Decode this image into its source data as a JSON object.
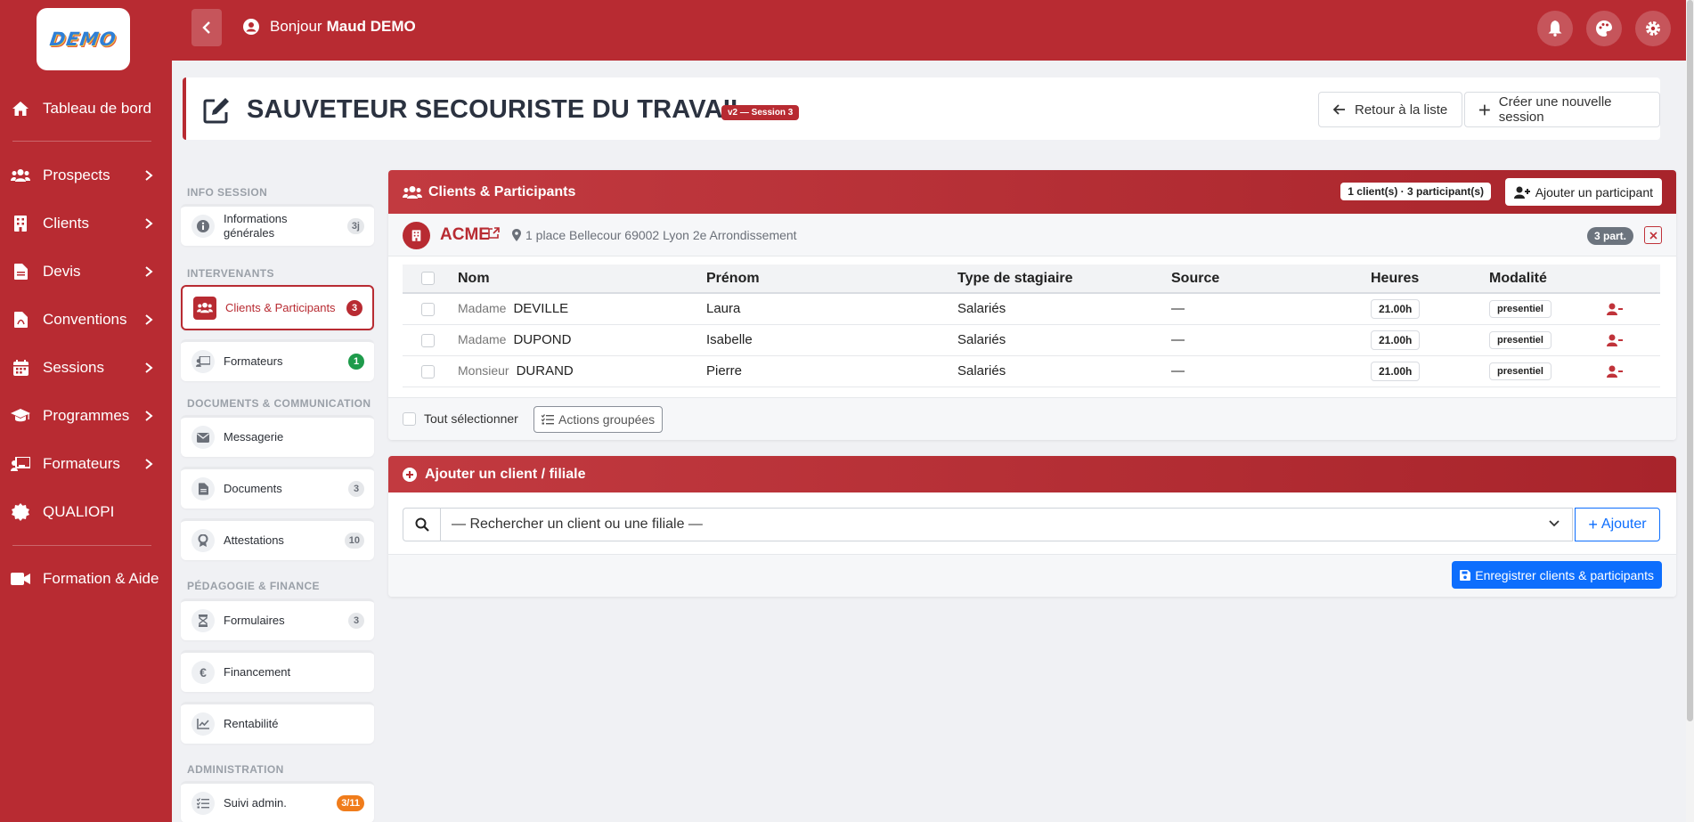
{
  "logo": {
    "text": "DEMO"
  },
  "sidebar": {
    "items": [
      {
        "label": "Tableau de bord",
        "icon": "home-icon",
        "chevron": false
      },
      {
        "label": "Prospects",
        "icon": "users-icon",
        "chevron": true
      },
      {
        "label": "Clients",
        "icon": "building-icon",
        "chevron": true
      },
      {
        "label": "Devis",
        "icon": "file-icon",
        "chevron": true
      },
      {
        "label": "Conventions",
        "icon": "file-pdf-icon",
        "chevron": true
      },
      {
        "label": "Sessions",
        "icon": "calendar-icon",
        "chevron": true
      },
      {
        "label": "Programmes",
        "icon": "graduation-cap-icon",
        "chevron": true
      },
      {
        "label": "Formateurs",
        "icon": "chalkboard-teacher-icon",
        "chevron": true
      },
      {
        "label": "QUALIOPI",
        "icon": "certificate-icon",
        "chevron": false
      },
      {
        "label": "Formation & Aide",
        "icon": "video-icon",
        "chevron": false
      }
    ]
  },
  "header": {
    "greeting": "Bonjour",
    "user_name": "Maud DEMO"
  },
  "title_card": {
    "title": "SAUVETEUR SECOURISTE DU TRAVAIL",
    "version_badge": "v2 — Session 3",
    "back_to_list": "Retour à la liste",
    "create_session": "Créer une nouvelle session"
  },
  "section_nav": {
    "groups": [
      {
        "heading": "INFO SESSION"
      },
      {
        "heading": "INTERVENANTS"
      },
      {
        "heading": "DOCUMENTS & COMMUNICATION"
      },
      {
        "heading": "PÉDAGOGIE & FINANCE"
      },
      {
        "heading": "ADMINISTRATION"
      }
    ],
    "items": [
      {
        "label": "Informations générales",
        "badge": "3j"
      },
      {
        "label": "Clients & Participants",
        "badge": "3"
      },
      {
        "label": "Formateurs",
        "badge": "1"
      },
      {
        "label": "Messagerie",
        "badge": ""
      },
      {
        "label": "Documents",
        "badge": "3"
      },
      {
        "label": "Attestations",
        "badge": "10"
      },
      {
        "label": "Formulaires",
        "badge": "3"
      },
      {
        "label": "Financement",
        "badge": ""
      },
      {
        "label": "Rentabilité",
        "badge": ""
      },
      {
        "label": "Suivi admin.",
        "badge": "3/11"
      }
    ]
  },
  "clients_panel": {
    "title": "Clients & Participants",
    "count_pill": "1 client(s) · 3 participant(s)",
    "add_participant": "Ajouter un participant",
    "client": {
      "name": "ACME",
      "address": "1 place Bellecour 69002 Lyon 2e Arrondissement",
      "participants_badge": "3 part."
    },
    "columns": [
      "Nom",
      "Prénom",
      "Type de stagiaire",
      "Source",
      "Heures",
      "Modalité"
    ],
    "rows": [
      {
        "civility": "Madame",
        "nom": "DEVILLE",
        "prenom": "Laura",
        "type": "Salariés",
        "source": "—",
        "heures": "21.00h",
        "modalite": "presentiel"
      },
      {
        "civility": "Madame",
        "nom": "DUPOND",
        "prenom": "Isabelle",
        "type": "Salariés",
        "source": "—",
        "heures": "21.00h",
        "modalite": "presentiel"
      },
      {
        "civility": "Monsieur",
        "nom": "DURAND",
        "prenom": "Pierre",
        "type": "Salariés",
        "source": "—",
        "heures": "21.00h",
        "modalite": "presentiel"
      }
    ],
    "select_all": "Tout sélectionner",
    "group_actions": "Actions groupées"
  },
  "add_client_panel": {
    "title": "Ajouter un client / filiale",
    "search_placeholder": "— Rechercher un client ou une filiale —",
    "add_label": "Ajouter",
    "save_label": "Enregistrer clients & participants"
  },
  "colors": {
    "brand": "#b82b32",
    "primary": "#0d6efd",
    "success": "#1e9b4b",
    "warning": "#f07c1b"
  }
}
